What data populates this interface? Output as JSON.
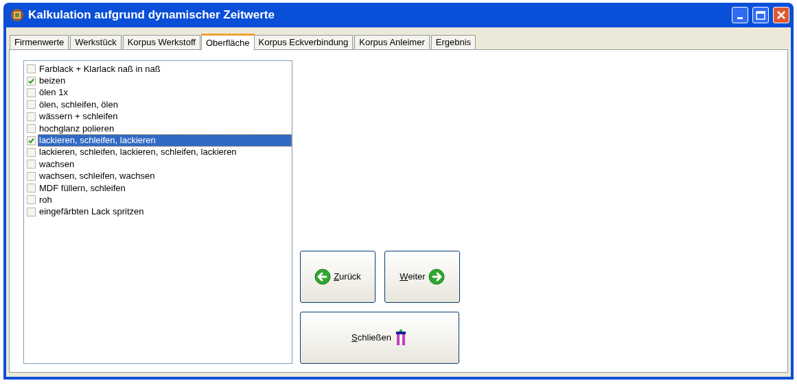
{
  "window": {
    "title": "Kalkulation aufgrund dynamischer Zeitwerte"
  },
  "tabs": [
    {
      "label": "Firmenwerte",
      "selected": false
    },
    {
      "label": "Werkstück",
      "selected": false
    },
    {
      "label": "Korpus Werkstoff",
      "selected": false
    },
    {
      "label": "Oberfläche",
      "selected": true
    },
    {
      "label": "Korpus Eckverbindung",
      "selected": false
    },
    {
      "label": "Korpus Anleimer",
      "selected": false
    },
    {
      "label": "Ergebnis",
      "selected": false
    }
  ],
  "options": [
    {
      "label": "Farblack + Klarlack naß in naß",
      "checked": false,
      "selected": false
    },
    {
      "label": "beizen",
      "checked": true,
      "selected": false
    },
    {
      "label": "ölen 1x",
      "checked": false,
      "selected": false
    },
    {
      "label": "ölen, schleifen, ölen",
      "checked": false,
      "selected": false
    },
    {
      "label": "wässern + schleifen",
      "checked": false,
      "selected": false
    },
    {
      "label": "hochglanz polieren",
      "checked": false,
      "selected": false
    },
    {
      "label": "lackieren, schleifen, lackieren",
      "checked": true,
      "selected": true
    },
    {
      "label": "lackieren, schleifen, lackieren, schleifen, lackieren",
      "checked": false,
      "selected": false
    },
    {
      "label": "wachsen",
      "checked": false,
      "selected": false
    },
    {
      "label": "wachsen, schleifen, wachsen",
      "checked": false,
      "selected": false
    },
    {
      "label": "MDF füllern, schleifen",
      "checked": false,
      "selected": false
    },
    {
      "label": "roh",
      "checked": false,
      "selected": false
    },
    {
      "label": "eingefärbten Lack spritzen",
      "checked": false,
      "selected": false
    }
  ],
  "buttons": [
    {
      "kind": "back",
      "label": "Zurück"
    },
    {
      "kind": "next",
      "label": "Weiter"
    },
    {
      "kind": "close",
      "label": "Schließen"
    }
  ]
}
